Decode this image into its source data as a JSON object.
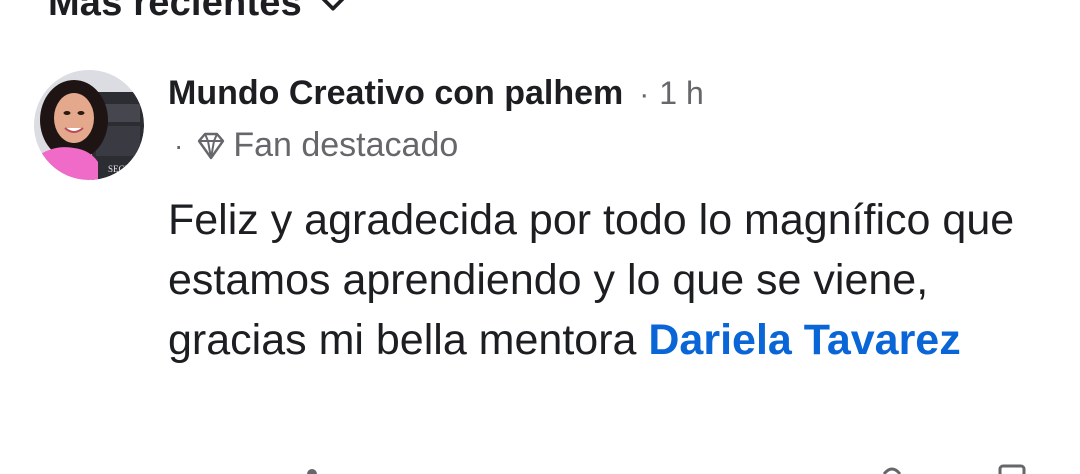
{
  "sort": {
    "label": "Más recientes"
  },
  "comment": {
    "author": "Mundo Creativo con palhem",
    "separator": "·",
    "time": "1 h",
    "badge": {
      "separator": "·",
      "icon": "diamond-icon",
      "label": "Fan destacado"
    },
    "text": "Feliz y agradecida por todo lo magnífico que estamos aprendiendo y lo que se viene, gracias mi bella mentora ",
    "mention": "Dariela Tavarez",
    "avatar": {
      "book_text": "SECRE"
    }
  },
  "colors": {
    "text": "#1c1e21",
    "secondary": "#65676b",
    "mention": "#0a66d6",
    "avatar_ring": "#f06ac8"
  }
}
